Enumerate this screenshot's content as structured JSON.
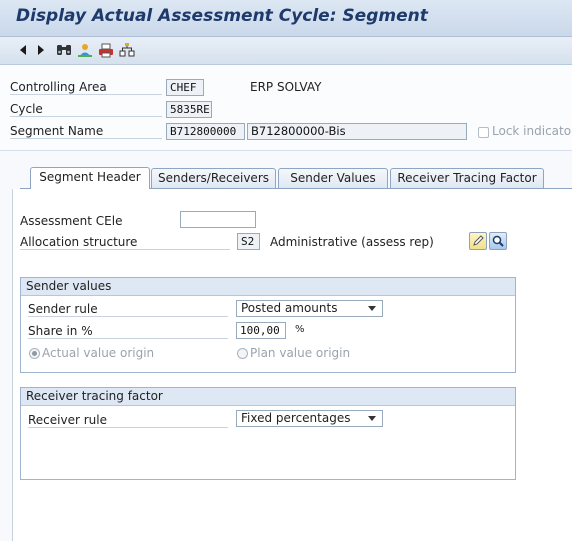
{
  "window": {
    "title": "Display Actual Assessment Cycle: Segment"
  },
  "toolbar": {
    "icons": [
      "back-icon",
      "forward-icon",
      "find-icon",
      "person-icon",
      "print-icon",
      "structure-icon"
    ]
  },
  "header": {
    "controlling_area": {
      "label": "Controlling Area",
      "value": "CHEF",
      "text": "ERP SOLVAY"
    },
    "cycle": {
      "label": "Cycle",
      "value": "5835RE"
    },
    "segment_name": {
      "label": "Segment Name",
      "value": "B712800000",
      "text": "B712800000-Bis"
    },
    "lock_indicator": {
      "label": "Lock indicator",
      "checked": false
    }
  },
  "tabs": [
    {
      "label": "Segment Header",
      "active": true
    },
    {
      "label": "Senders/Receivers",
      "active": false
    },
    {
      "label": "Sender Values",
      "active": false
    },
    {
      "label": "Receiver Tracing Factor",
      "active": false
    }
  ],
  "segment_header": {
    "assessment_cele": {
      "label": "Assessment CEle",
      "value": ""
    },
    "allocation_structure": {
      "label": "Allocation structure",
      "value": "S2",
      "text": "Administrative (assess rep)"
    }
  },
  "sender_values": {
    "title": "Sender values",
    "sender_rule": {
      "label": "Sender rule",
      "value": "Posted amounts"
    },
    "share": {
      "label": "Share in %",
      "value": "100,00",
      "unit": "%"
    },
    "actual_origin": {
      "label": "Actual value origin",
      "selected": true
    },
    "plan_origin": {
      "label": "Plan value origin",
      "selected": false
    }
  },
  "receiver_tracing": {
    "title": "Receiver tracing factor",
    "receiver_rule": {
      "label": "Receiver rule",
      "value": "Fixed percentages"
    }
  },
  "colors": {
    "title_text": "#1d3a6b",
    "group_header": "#dde8f4",
    "border": "#8ea6c3"
  }
}
